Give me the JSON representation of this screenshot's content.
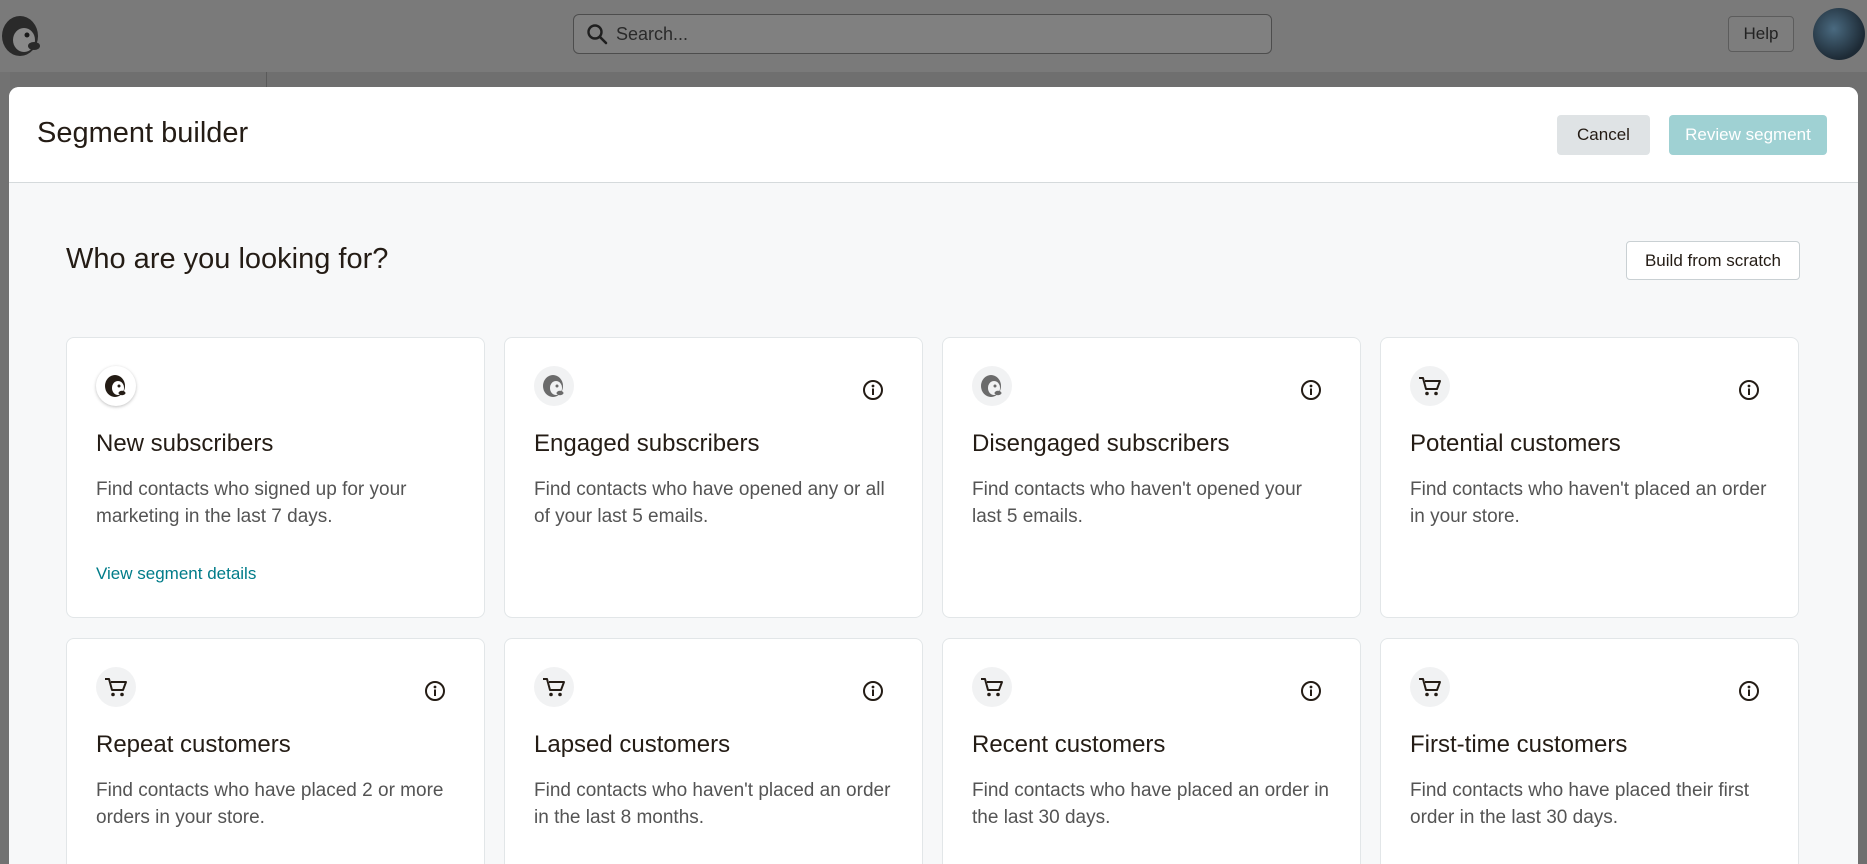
{
  "topbar": {
    "search_placeholder": "Search...",
    "help_label": "Help"
  },
  "modal": {
    "title": "Segment builder",
    "cancel_label": "Cancel",
    "review_label": "Review segment"
  },
  "section": {
    "title": "Who are you looking for?",
    "scratch_label": "Build from scratch"
  },
  "cards": [
    {
      "icon": "mailchimp-icon",
      "title": "New subscribers",
      "desc": "Find contacts who signed up for your marketing in the last 7 days.",
      "link": "View segment details"
    },
    {
      "icon": "mailchimp-icon",
      "title": "Engaged subscribers",
      "desc": "Find contacts who have opened any or all of your last 5 emails."
    },
    {
      "icon": "mailchimp-icon",
      "title": "Disengaged subscribers",
      "desc": "Find contacts who haven't opened your last 5 emails."
    },
    {
      "icon": "cart-icon",
      "title": "Potential customers",
      "desc": "Find contacts who haven't placed an order in your store."
    },
    {
      "icon": "cart-icon",
      "title": "Repeat customers",
      "desc": "Find contacts who have placed 2 or more orders in your store."
    },
    {
      "icon": "cart-icon",
      "title": "Lapsed customers",
      "desc": "Find contacts who haven't placed an order in the last 8 months."
    },
    {
      "icon": "cart-icon",
      "title": "Recent customers",
      "desc": "Find contacts who have placed an order in the last 30 days."
    },
    {
      "icon": "cart-icon",
      "title": "First-time customers",
      "desc": "Find contacts who have placed their first order in the last 30 days."
    }
  ],
  "colors": {
    "link": "#007c89",
    "review_button": "#9fd1d3",
    "cancel_button": "#dfe3e5"
  }
}
